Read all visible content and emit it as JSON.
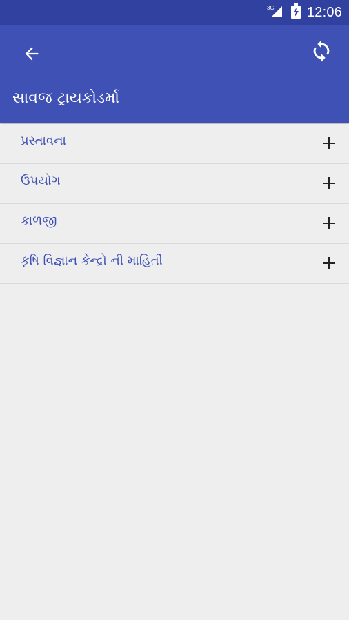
{
  "status_bar": {
    "network": "3G",
    "time": "12:06",
    "icons": [
      "signal-3g-icon",
      "battery-charging-icon"
    ]
  },
  "toolbar": {
    "back_icon": "arrow-back-icon",
    "refresh_icon": "refresh-icon",
    "title": "સાવજ ટ્રાયકોડર્મા"
  },
  "list": {
    "items": [
      {
        "label": "પ્રસ્તાવના",
        "icon": "plus-icon"
      },
      {
        "label": "ઉપયોગ",
        "icon": "plus-icon"
      },
      {
        "label": "કાળજી",
        "icon": "plus-icon"
      },
      {
        "label": "કૃષિ વિજ્ઞાન કેન્દ્રો ની માહિતી",
        "icon": "plus-icon"
      }
    ]
  },
  "colors": {
    "primary": "#3f51b5",
    "primary_dark": "#3141a0",
    "background": "#eeeeee",
    "label_text": "#3f51b5",
    "icon_dark": "#222222"
  }
}
